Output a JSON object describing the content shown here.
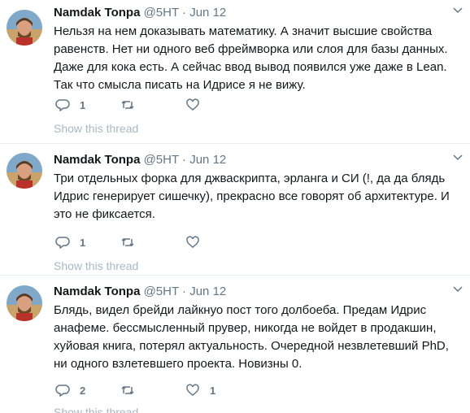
{
  "colors": {
    "text": "#14171a",
    "secondary": "#657786",
    "muted": "#aab8c2",
    "divider": "#e6ecf0"
  },
  "tweets": [
    {
      "name": "Namdak Tonpa",
      "handle": "@5HT",
      "separator": "·",
      "date": "Jun 12",
      "text": "Нельзя на нем доказывать математику. А значит высшие свойства равенств. Нет ни одного веб фреймворка или слоя для базы данных. Даже для кока есть. А сейчас ввод вывод появился уже даже в Lean. Так что смысла писать на Идрисе я не вижу.",
      "replies": "1",
      "retweets": "",
      "likes": "",
      "show_thread": "Show this thread",
      "icons": [
        "avatar",
        "chevron-down-icon",
        "reply-icon",
        "retweet-icon",
        "like-icon"
      ]
    },
    {
      "name": "Namdak Tonpa",
      "handle": "@5HT",
      "separator": "·",
      "date": "Jun 12",
      "text": "Три отдельных форка для джваскрипта, эрланга и СИ (!, да да блядь Идрис генерирует сишечку), прекрасно все говорят об архитектуре. И это не фиксается.",
      "replies": "1",
      "retweets": "",
      "likes": "",
      "show_thread": "Show this thread",
      "icons": [
        "avatar",
        "chevron-down-icon",
        "reply-icon",
        "retweet-icon",
        "like-icon"
      ]
    },
    {
      "name": "Namdak Tonpa",
      "handle": "@5HT",
      "separator": "·",
      "date": "Jun 12",
      "text": "Блядь, видел брейди лайкнуо пост того долбоеба. Предам Идрис анафеме. бессмысленный прувер, никогда не войдет в продакшин, хуйовая книга, потерял актуальность. Очередной незвлетевший PhD, ни одного взлетевшего проекта. Новизны 0.",
      "replies": "2",
      "retweets": "",
      "likes": "1",
      "show_thread": "Show this thread",
      "icons": [
        "avatar",
        "chevron-down-icon",
        "reply-icon",
        "retweet-icon",
        "like-icon"
      ]
    }
  ]
}
